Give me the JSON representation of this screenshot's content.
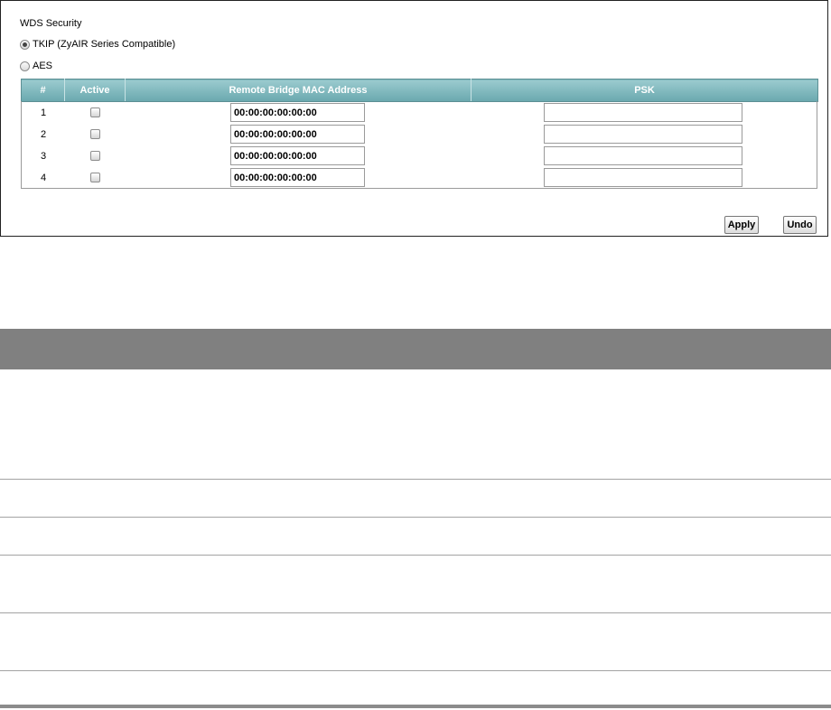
{
  "wds": {
    "title": "WDS Security",
    "options": [
      {
        "label": "TKIP (ZyAIR Series Compatible)",
        "checked": true
      },
      {
        "label": "AES",
        "checked": false
      }
    ],
    "table": {
      "headers": [
        "#",
        "Active",
        "Remote Bridge MAC Address",
        "PSK"
      ],
      "rows": [
        {
          "num": "1",
          "active": false,
          "mac": "00:00:00:00:00:00",
          "psk": ""
        },
        {
          "num": "2",
          "active": false,
          "mac": "00:00:00:00:00:00",
          "psk": ""
        },
        {
          "num": "3",
          "active": false,
          "mac": "00:00:00:00:00:00",
          "psk": ""
        },
        {
          "num": "4",
          "active": false,
          "mac": "00:00:00:00:00:00",
          "psk": ""
        }
      ]
    },
    "buttons": {
      "apply": "Apply",
      "undo": "Undo"
    }
  },
  "colors": {
    "header_teal": "#7ab6bb",
    "doc_header_gray": "#808080"
  }
}
